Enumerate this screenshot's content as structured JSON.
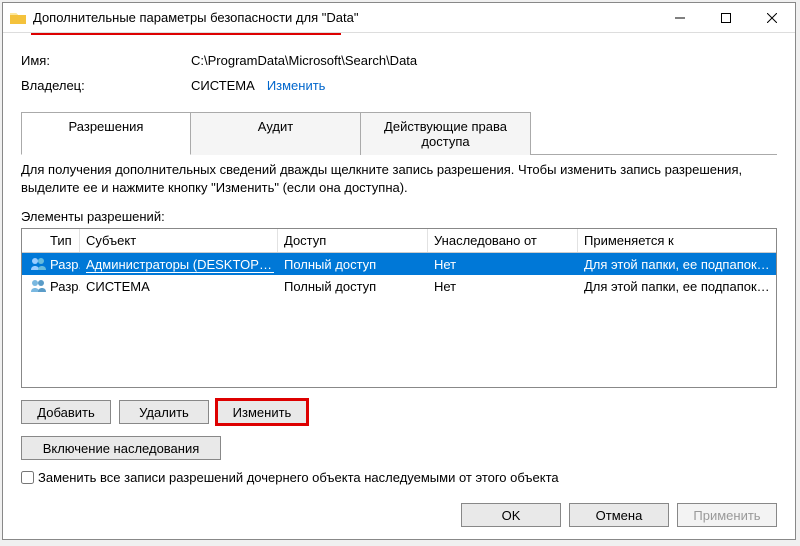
{
  "titlebar": {
    "title": "Дополнительные параметры безопасности  для \"Data\""
  },
  "fields": {
    "name_label": "Имя:",
    "name_value": "C:\\ProgramData\\Microsoft\\Search\\Data",
    "owner_label": "Владелец:",
    "owner_value": "СИСТЕМА",
    "owner_change": "Изменить"
  },
  "tabs": {
    "perm": "Разрешения",
    "audit": "Аудит",
    "effective": "Действующие права доступа"
  },
  "help": "Для получения дополнительных сведений дважды щелкните запись разрешения. Чтобы изменить запись разрешения, выделите ее и нажмите кнопку \"Изменить\" (если она доступна).",
  "list_label": "Элементы разрешений:",
  "headers": {
    "type": "Тип",
    "subject": "Субъект",
    "access": "Доступ",
    "inherited": "Унаследовано от",
    "applies": "Применяется к"
  },
  "rows": [
    {
      "type": "Разр...",
      "subject": "Администраторы (DESKTOP-...",
      "access": "Полный доступ",
      "inherited": "Нет",
      "applies": "Для этой папки, ее подпапок ...",
      "selected": true
    },
    {
      "type": "Разр...",
      "subject": "СИСТЕМА",
      "access": "Полный доступ",
      "inherited": "Нет",
      "applies": "Для этой папки, ее подпапок ...",
      "selected": false
    }
  ],
  "buttons": {
    "add": "Добавить",
    "remove": "Удалить",
    "edit": "Изменить",
    "enable_inherit": "Включение наследования"
  },
  "checkbox": {
    "replace": "Заменить все записи разрешений дочернего объекта наследуемыми от этого объекта"
  },
  "footer": {
    "ok": "OK",
    "cancel": "Отмена",
    "apply": "Применить"
  }
}
